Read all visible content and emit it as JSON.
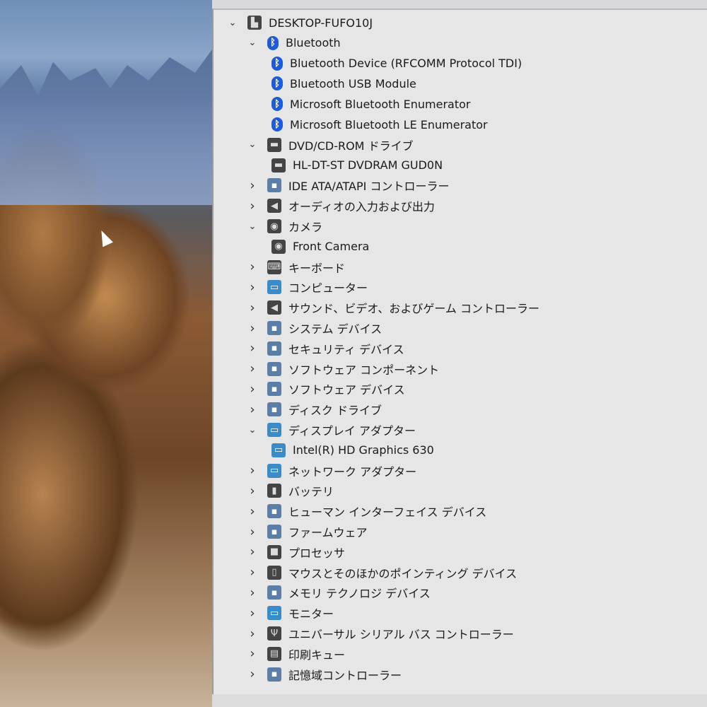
{
  "colors": {
    "panel_bg": "#e6e6e6",
    "bluetooth": "#1e5bd6"
  },
  "tree": [
    {
      "label": "DESKTOP-FUFO10J",
      "level": 0,
      "state": "expanded",
      "icon": "computer-icon"
    },
    {
      "label": "Bluetooth",
      "level": 1,
      "state": "expanded",
      "icon": "bluetooth-icon"
    },
    {
      "label": "Bluetooth Device (RFCOMM Protocol TDI)",
      "level": 2,
      "icon": "bluetooth-icon"
    },
    {
      "label": "Bluetooth USB Module",
      "level": 2,
      "icon": "bluetooth-icon"
    },
    {
      "label": "Microsoft Bluetooth Enumerator",
      "level": 2,
      "icon": "bluetooth-icon"
    },
    {
      "label": "Microsoft Bluetooth LE Enumerator",
      "level": 2,
      "icon": "bluetooth-icon"
    },
    {
      "label": "DVD/CD-ROM ドライブ",
      "level": 1,
      "state": "expanded",
      "icon": "dvd-drive-icon"
    },
    {
      "label": "HL-DT-ST DVDRAM GUD0N",
      "level": 2,
      "icon": "dvd-drive-icon"
    },
    {
      "label": "IDE ATA/ATAPI コントローラー",
      "level": 1,
      "state": "collapsed",
      "icon": "ide-controller-icon"
    },
    {
      "label": "オーディオの入力および出力",
      "level": 1,
      "state": "collapsed",
      "icon": "speaker-icon"
    },
    {
      "label": "カメラ",
      "level": 1,
      "state": "expanded",
      "icon": "camera-icon"
    },
    {
      "label": "Front Camera",
      "level": 2,
      "icon": "camera-icon"
    },
    {
      "label": "キーボード",
      "level": 1,
      "state": "collapsed",
      "icon": "keyboard-icon"
    },
    {
      "label": "コンピューター",
      "level": 1,
      "state": "collapsed",
      "icon": "monitor-icon"
    },
    {
      "label": "サウンド、ビデオ、およびゲーム コントローラー",
      "level": 1,
      "state": "collapsed",
      "icon": "speaker-icon"
    },
    {
      "label": "システム デバイス",
      "level": 1,
      "state": "collapsed",
      "icon": "system-device-icon"
    },
    {
      "label": "セキュリティ デバイス",
      "level": 1,
      "state": "collapsed",
      "icon": "security-key-icon"
    },
    {
      "label": "ソフトウェア コンポーネント",
      "level": 1,
      "state": "collapsed",
      "icon": "software-component-icon"
    },
    {
      "label": "ソフトウェア デバイス",
      "level": 1,
      "state": "collapsed",
      "icon": "software-device-icon"
    },
    {
      "label": "ディスク ドライブ",
      "level": 1,
      "state": "collapsed",
      "icon": "disk-drive-icon"
    },
    {
      "label": "ディスプレイ アダプター",
      "level": 1,
      "state": "expanded",
      "icon": "display-adapter-icon"
    },
    {
      "label": "Intel(R) HD Graphics 630",
      "level": 2,
      "icon": "display-adapter-icon"
    },
    {
      "label": "ネットワーク アダプター",
      "level": 1,
      "state": "collapsed",
      "icon": "network-adapter-icon"
    },
    {
      "label": "バッテリ",
      "level": 1,
      "state": "collapsed",
      "icon": "battery-icon"
    },
    {
      "label": "ヒューマン インターフェイス デバイス",
      "level": 1,
      "state": "collapsed",
      "icon": "hid-icon"
    },
    {
      "label": "ファームウェア",
      "level": 1,
      "state": "collapsed",
      "icon": "firmware-icon"
    },
    {
      "label": "プロセッサ",
      "level": 1,
      "state": "collapsed",
      "icon": "processor-icon"
    },
    {
      "label": "マウスとそのほかのポインティング デバイス",
      "level": 1,
      "state": "collapsed",
      "icon": "mouse-icon"
    },
    {
      "label": "メモリ テクノロジ デバイス",
      "level": 1,
      "state": "collapsed",
      "icon": "memory-icon"
    },
    {
      "label": "モニター",
      "level": 1,
      "state": "collapsed",
      "icon": "monitor-icon"
    },
    {
      "label": "ユニバーサル シリアル バス コントローラー",
      "level": 1,
      "state": "collapsed",
      "icon": "usb-icon"
    },
    {
      "label": "印刷キュー",
      "level": 1,
      "state": "collapsed",
      "icon": "printer-icon"
    },
    {
      "label": "記憶域コントローラー",
      "level": 1,
      "state": "collapsed",
      "icon": "storage-controller-icon"
    }
  ]
}
